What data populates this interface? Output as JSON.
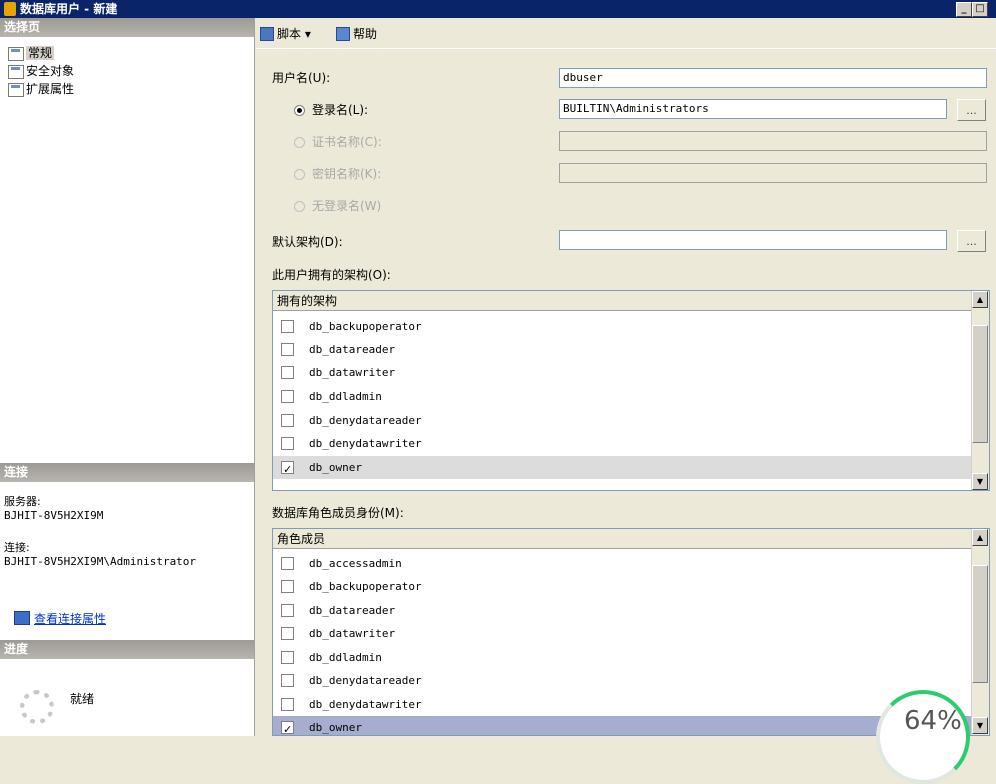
{
  "window": {
    "title": "数据库用户 - 新建",
    "min_label": "_",
    "max_label": "□"
  },
  "left": {
    "select_page_header": "选择页",
    "nav_items": [
      {
        "label": "常规",
        "icon": "page-icon",
        "selected": true
      },
      {
        "label": "安全对象",
        "icon": "page-icon",
        "selected": false
      },
      {
        "label": "扩展属性",
        "icon": "page-icon",
        "selected": false
      }
    ],
    "connection_header": "连接",
    "server_label": "服务器:",
    "server_value": "BJHIT-8V5H2XI9M",
    "connection_label": "连接:",
    "connection_value": "BJHIT-8V5H2XI9M\\Administrator",
    "view_props_link": "查看连接属性",
    "progress_header": "进度",
    "progress_status": "就绪"
  },
  "toolbar": {
    "script_label": "脚本",
    "script_dropdown": "▾",
    "help_label": "帮助"
  },
  "form": {
    "username_label": "用户名(U):",
    "username_value": "dbuser",
    "login_radio_label": "登录名(L):",
    "login_value": "BUILTIN\\Administrators",
    "cert_radio_label": "证书名称(C):",
    "key_radio_label": "密钥名称(K):",
    "nologin_radio_label": "无登录名(W)",
    "default_schema_label": "默认架构(D):",
    "default_schema_value": "",
    "browse_label": "...",
    "owned_schemas_label": "此用户拥有的架构(O):",
    "role_membership_label": "数据库角色成员身份(M):"
  },
  "owned_schemas": {
    "header": "拥有的架构",
    "rows": [
      {
        "name": "db_backupoperator",
        "checked": false
      },
      {
        "name": "db_datareader",
        "checked": false
      },
      {
        "name": "db_datawriter",
        "checked": false
      },
      {
        "name": "db_ddladmin",
        "checked": false
      },
      {
        "name": "db_denydatareader",
        "checked": false
      },
      {
        "name": "db_denydatawriter",
        "checked": false
      },
      {
        "name": "db_owner",
        "checked": true
      }
    ]
  },
  "role_members": {
    "header": "角色成员",
    "rows": [
      {
        "name": "db_accessadmin",
        "checked": false
      },
      {
        "name": "db_backupoperator",
        "checked": false
      },
      {
        "name": "db_datareader",
        "checked": false
      },
      {
        "name": "db_datawriter",
        "checked": false
      },
      {
        "name": "db_ddladmin",
        "checked": false
      },
      {
        "name": "db_denydatareader",
        "checked": false
      },
      {
        "name": "db_denydatawriter",
        "checked": false
      },
      {
        "name": "db_owner",
        "checked": true
      }
    ]
  },
  "overlay": {
    "percent_label": "64%"
  },
  "colors": {
    "title_bar": "#0a246a",
    "section_header": "#9c9a94",
    "link": "#0033cc",
    "progress_ring": "#2ecc71"
  }
}
